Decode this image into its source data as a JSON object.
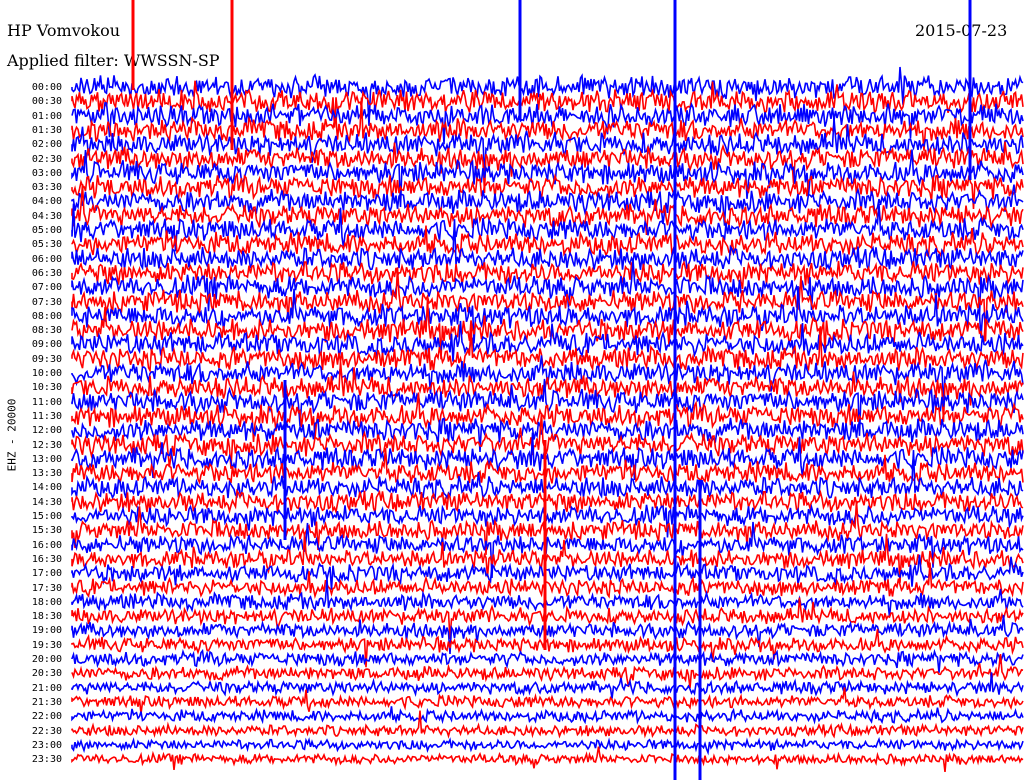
{
  "header": {
    "station": "HP Vomvokou",
    "filter": "Applied filter: WWSSN-SP",
    "date": "2015-07-23"
  },
  "chart_data": {
    "type": "line",
    "title": "HP Vomvokou",
    "subtitle": "Applied filter: WWSSN-SP",
    "ylabel": "EHZ - 20000",
    "date": "2015-07-23",
    "y_tick_labels": [
      "00:00",
      "00:30",
      "01:00",
      "01:30",
      "02:00",
      "02:30",
      "03:00",
      "03:30",
      "04:00",
      "04:30",
      "05:00",
      "05:30",
      "06:00",
      "06:30",
      "07:00",
      "07:30",
      "08:00",
      "08:30",
      "09:00",
      "09:30",
      "10:00",
      "10:30",
      "11:00",
      "11:30",
      "12:00",
      "12:30",
      "13:00",
      "13:30",
      "14:00",
      "14:30",
      "15:00",
      "15:30",
      "16:00",
      "16:30",
      "17:00",
      "17:30",
      "18:00",
      "18:30",
      "19:00",
      "19:30",
      "20:00",
      "20:30",
      "21:00",
      "21:30",
      "22:00",
      "22:30",
      "23:00",
      "23:30"
    ],
    "series_colors": [
      "#0000ff",
      "#ff0000"
    ],
    "grid": false,
    "legend": "none"
  }
}
